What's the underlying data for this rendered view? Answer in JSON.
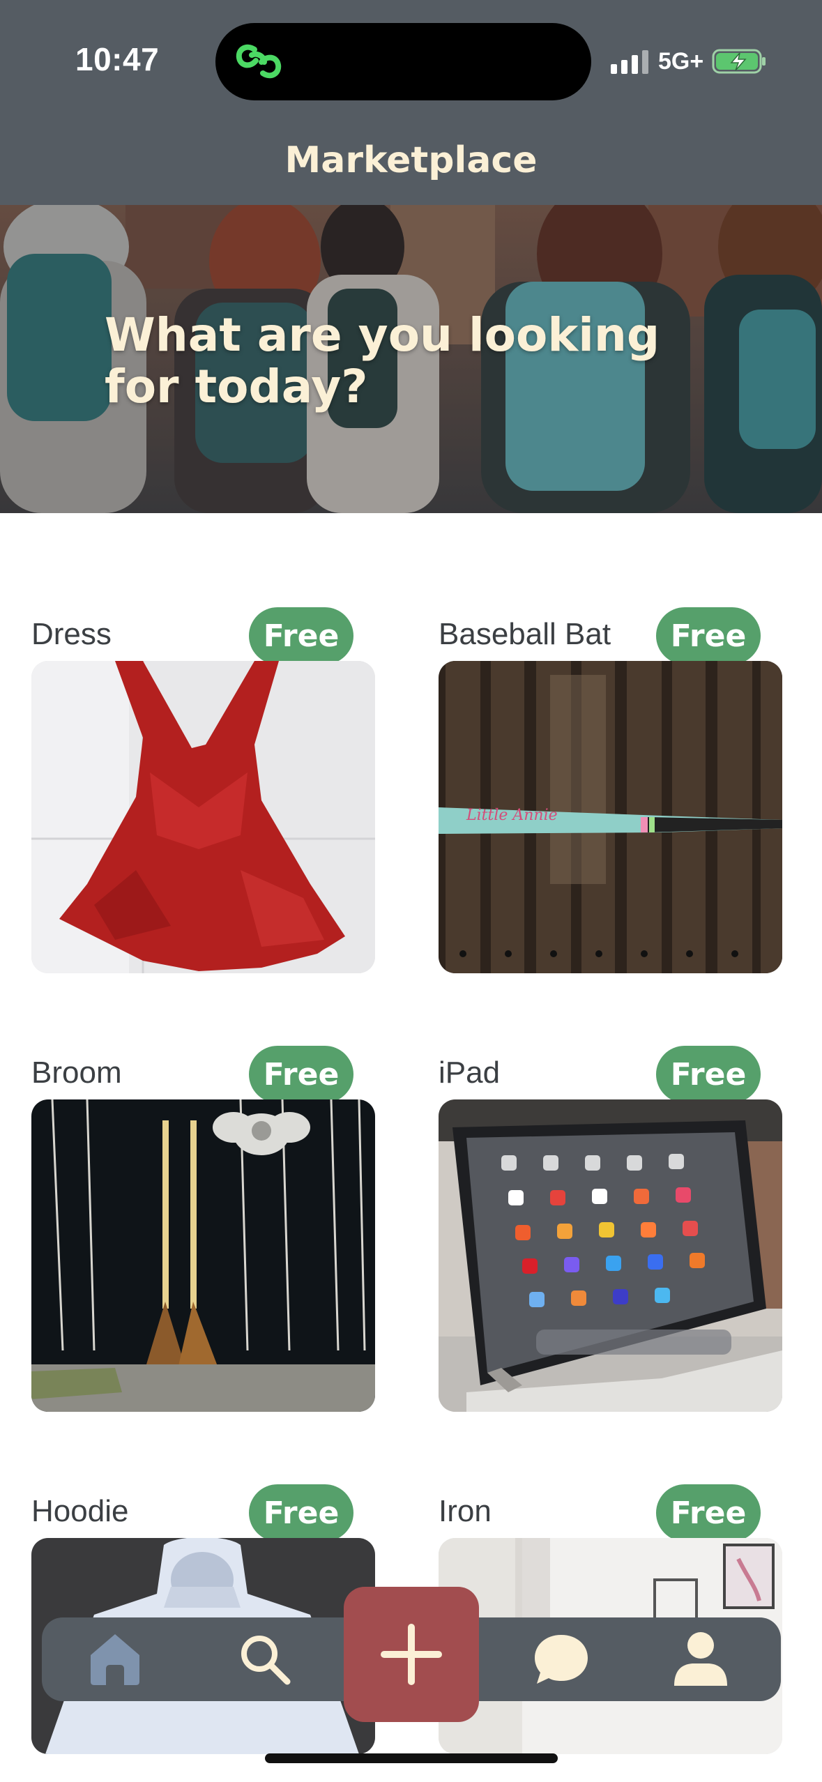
{
  "status_bar": {
    "time": "10:47",
    "network": "5G+",
    "island_icon": "link-rings-icon"
  },
  "header": {
    "title": "Marketplace",
    "background_color": "#555c63",
    "title_color": "#fbf0d6"
  },
  "hero": {
    "headline": "What are you looking for today?"
  },
  "items": [
    {
      "name": "Dress",
      "price_badge": "Free",
      "image": "red-sequin-dress-photo"
    },
    {
      "name": "Baseball Bat",
      "price_badge": "Free",
      "image": "baseball-bat-on-wood-photo"
    },
    {
      "name": "Broom",
      "price_badge": "Free",
      "image": "two-brooms-photo"
    },
    {
      "name": "iPad",
      "price_badge": "Free",
      "image": "ipad-with-keyboard-photo"
    },
    {
      "name": "Hoodie",
      "price_badge": "Free",
      "image": "white-hoodie-photo"
    },
    {
      "name": "Iron",
      "price_badge": "Free",
      "image": "iron-room-photo"
    }
  ],
  "bottom_nav": {
    "items": [
      "home-icon",
      "search-icon",
      "add-icon",
      "chat-bubble-icon",
      "profile-icon"
    ],
    "add_button_color": "#a24d4f",
    "active_icon_color": "#7f93ad",
    "inactive_icon_color": "#fbf0d6"
  },
  "colors": {
    "badge_green": "#56a06b"
  }
}
